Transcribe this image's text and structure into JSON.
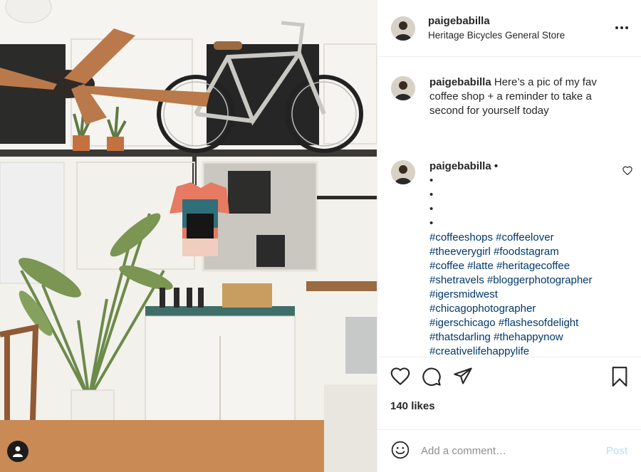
{
  "header": {
    "username": "paigebabilla",
    "location": "Heritage Bicycles General Store",
    "more_icon": "more-horizontal-icon"
  },
  "caption": {
    "username": "paigebabilla",
    "text": "Here’s a pic of my fav coffee shop + a reminder to take a second for yourself today"
  },
  "hashtag_comment": {
    "username": "paigebabilla",
    "separator": "•",
    "dots": [
      "•",
      "•",
      "•",
      "•"
    ],
    "hashtag_lines": [
      "#coffeeshops #coffeelover",
      "#theeverygirl #foodstagram",
      "#coffee #latte #heritagecoffee",
      "#shetravels #bloggerphotographer",
      "#igersmidwest",
      "#chicagophotographer",
      "#igerschicago #flashesofdelight",
      "#thatsdarling #thehappynow",
      "#creativelifehappylife"
    ]
  },
  "actions": {
    "icons": [
      "heart-icon",
      "comment-icon",
      "share-icon",
      "bookmark-icon"
    ]
  },
  "likes": "140 likes",
  "add_comment": {
    "placeholder": "Add a comment…",
    "post_label": "Post"
  },
  "colors": {
    "text": "#262626",
    "hashtag": "#00376b",
    "post_disabled": "#b2dffc",
    "divider": "#efefef"
  }
}
